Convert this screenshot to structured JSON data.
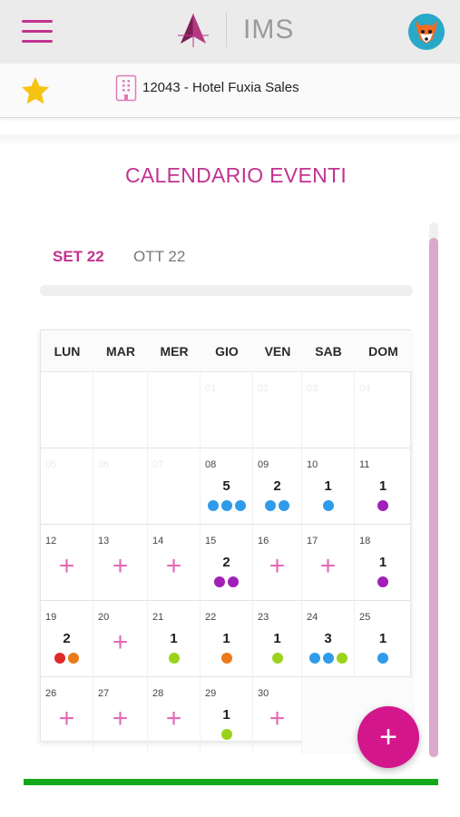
{
  "header": {
    "logo_text": "IMS",
    "icons": {
      "menu": "hamburger-menu-icon",
      "avatar": "fox-avatar-icon",
      "logo": "ims-logo-icon"
    },
    "brand_color": "#c2338f"
  },
  "hotel_bar": {
    "favorite_icon": "star-icon",
    "building_icon": "building-icon",
    "hotel_name": "12043 - Hotel Fuxia Sales"
  },
  "page": {
    "title": "CALENDARIO EVENTI"
  },
  "month_tabs": [
    {
      "label": "SET 22",
      "active": true
    },
    {
      "label": "OTT 22",
      "active": false
    }
  ],
  "calendar": {
    "weekdays": [
      "LUN",
      "MAR",
      "MER",
      "GIO",
      "VEN",
      "SAB",
      "DOM"
    ],
    "dot_colors": {
      "blue": "#2f9bea",
      "purple": "#a020b8",
      "red": "#e02a2a",
      "orange": "#ea7a1a",
      "green": "#9bd21c"
    },
    "weeks": [
      [
        {
          "day": "",
          "faded": true
        },
        {
          "day": "",
          "faded": true
        },
        {
          "day": "",
          "faded": true
        },
        {
          "day": "01",
          "faded": true
        },
        {
          "day": "02",
          "faded": true
        },
        {
          "day": "03",
          "faded": true
        },
        {
          "day": "04",
          "faded": true
        }
      ],
      [
        {
          "day": "05",
          "faded": true
        },
        {
          "day": "06",
          "faded": true
        },
        {
          "day": "07",
          "faded": true
        },
        {
          "day": "08",
          "count": "5",
          "dots": [
            "blue",
            "blue",
            "blue"
          ]
        },
        {
          "day": "09",
          "count": "2",
          "dots": [
            "blue",
            "blue"
          ]
        },
        {
          "day": "10",
          "count": "1",
          "dots": [
            "blue"
          ]
        },
        {
          "day": "11",
          "count": "1",
          "dots": [
            "purple"
          ]
        }
      ],
      [
        {
          "day": "12",
          "add": true
        },
        {
          "day": "13",
          "add": true
        },
        {
          "day": "14",
          "add": true
        },
        {
          "day": "15",
          "count": "2",
          "dots": [
            "purple",
            "purple"
          ]
        },
        {
          "day": "16",
          "add": true
        },
        {
          "day": "17",
          "add": true
        },
        {
          "day": "18",
          "count": "1",
          "dots": [
            "purple"
          ]
        }
      ],
      [
        {
          "day": "19",
          "count": "2",
          "dots": [
            "red",
            "orange"
          ]
        },
        {
          "day": "20",
          "add": true
        },
        {
          "day": "21",
          "count": "1",
          "dots": [
            "green"
          ]
        },
        {
          "day": "22",
          "count": "1",
          "dots": [
            "orange"
          ]
        },
        {
          "day": "23",
          "count": "1",
          "dots": [
            "green"
          ]
        },
        {
          "day": "24",
          "count": "3",
          "dots": [
            "blue",
            "blue",
            "green"
          ]
        },
        {
          "day": "25",
          "count": "1",
          "dots": [
            "blue"
          ]
        }
      ],
      [
        {
          "day": "26",
          "add": true
        },
        {
          "day": "27",
          "add": true
        },
        {
          "day": "28",
          "add": true
        },
        {
          "day": "29",
          "count": "1",
          "dots": [
            "green"
          ]
        },
        {
          "day": "30",
          "add": true
        },
        {
          "empty": true
        },
        {
          "empty": true
        }
      ]
    ],
    "add_glyph": "+"
  },
  "fab": {
    "label": "+",
    "icon": "plus-icon"
  }
}
